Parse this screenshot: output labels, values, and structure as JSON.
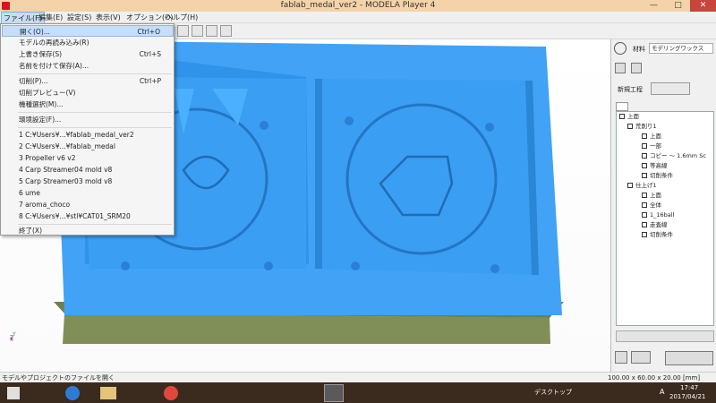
{
  "window": {
    "title": "fablab_medal_ver2 - MODELA Player 4",
    "minimize": "—",
    "maximize": "□",
    "close": "✕"
  },
  "menubar": [
    "ファイル(F)",
    "編集(E)",
    "設定(S)",
    "表示(V)",
    "オプション(O)",
    "ヘルプ(H)"
  ],
  "file_menu": {
    "items": [
      {
        "label": "開く(O)...",
        "shortcut": "Ctrl+O"
      },
      {
        "label": "モデルの再読み込み(R)",
        "shortcut": ""
      },
      {
        "label": "上書き保存(S)",
        "shortcut": "Ctrl+S"
      },
      {
        "label": "名前を付けて保存(A)...",
        "shortcut": ""
      },
      {
        "label": "切削(P)...",
        "shortcut": "Ctrl+P"
      },
      {
        "label": "切削プレビュー(V)",
        "shortcut": ""
      },
      {
        "label": "機種選択(M)...",
        "shortcut": ""
      },
      {
        "label": "環境設定(F)...",
        "shortcut": ""
      },
      {
        "label": "1 C:¥Users¥...¥fablab_medal_ver2",
        "shortcut": ""
      },
      {
        "label": "2 C:¥Users¥...¥fablab_medal",
        "shortcut": ""
      },
      {
        "label": "3 Propeller v6 v2",
        "shortcut": ""
      },
      {
        "label": "4 Carp Streamer04 mold v8",
        "shortcut": ""
      },
      {
        "label": "5 Carp Streamer03 mold v8",
        "shortcut": ""
      },
      {
        "label": "6 ume",
        "shortcut": ""
      },
      {
        "label": "7 aroma_choco",
        "shortcut": ""
      },
      {
        "label": "8 C:¥Users¥...¥stl¥CAT01_SRM20",
        "shortcut": ""
      },
      {
        "label": "終了(X)",
        "shortcut": ""
      }
    ]
  },
  "right_panel": {
    "material_label": "材料",
    "material_value": "モデリングワックス",
    "new_process_label": "新規工程",
    "tree": [
      {
        "label": "上面",
        "level": 0
      },
      {
        "label": "荒削り1",
        "level": 1
      },
      {
        "label": "上面",
        "level": 2
      },
      {
        "label": "一部",
        "level": 2
      },
      {
        "label": "コピー ～ 1.6mm Sc",
        "level": 2
      },
      {
        "label": "等高線",
        "level": 2
      },
      {
        "label": "切削条件",
        "level": 2
      },
      {
        "label": "仕上げ1",
        "level": 1
      },
      {
        "label": "上面",
        "level": 2
      },
      {
        "label": "全体",
        "level": 2
      },
      {
        "label": "1_16ball",
        "level": 2
      },
      {
        "label": "走査線",
        "level": 2
      },
      {
        "label": "切削条件",
        "level": 2
      }
    ]
  },
  "status": {
    "left": "モデルやプロジェクトのファイルを開く",
    "dimensions": "100.00 x 60.00 x 20.00 [mm]"
  },
  "taskbar": {
    "desktop_label": "デスクトップ",
    "time": "17:47",
    "date": "2017/04/21",
    "lang": "A"
  },
  "axes": {
    "x": "X",
    "y": "Y",
    "z": "Z"
  },
  "colors": {
    "model": "#3ea2f7",
    "model_side": "#7b8b55",
    "titlebar": "#f4d3a8"
  }
}
